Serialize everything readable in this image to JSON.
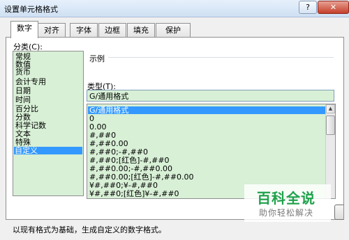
{
  "window": {
    "title": "设置单元格格式",
    "help_label": "?",
    "close_label": "✕"
  },
  "tabs": [
    "数字",
    "对齐",
    "字体",
    "边框",
    "填充",
    "保护"
  ],
  "category": {
    "label": "分类(C):",
    "items": [
      "常规",
      "数值",
      "货币",
      "会计专用",
      "日期",
      "时间",
      "百分比",
      "分数",
      "科学记数",
      "文本",
      "特殊",
      "自定义"
    ],
    "selected": "自定义"
  },
  "sample": {
    "label": "示例"
  },
  "type": {
    "label": "类型(T):",
    "value": "G/通用格式",
    "formats": [
      "G/通用格式",
      "0",
      "0.00",
      "#,##0",
      "#,##0.00",
      "#,##0;-#,##0",
      "#,##0;[红色]-#,##0",
      "#,##0.00;-#,##0.00",
      "#,##0.00;[红色]-#,##0.00",
      "¥#,##0;¥-#,##0",
      "¥#,##0;[红色]¥-#,##0"
    ],
    "selected": "G/通用格式"
  },
  "description": "以现有格式为基础，生成自定义的数字格式。",
  "watermark": {
    "logo": "百科全说",
    "sub": "助你轻松解决"
  },
  "colors": {
    "selection": "#3399ff",
    "list_bg": "#d8f0d6",
    "brand_green": "#1fa14b"
  }
}
